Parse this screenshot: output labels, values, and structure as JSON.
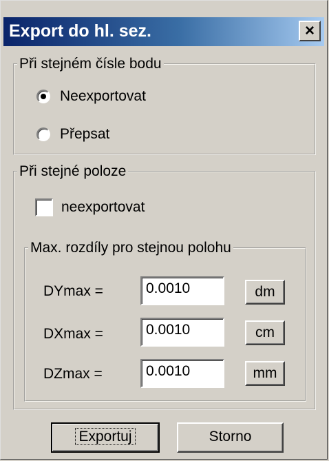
{
  "window": {
    "title": "Export do hl. sez.",
    "close_symbol": "×",
    "close_icon": "close-icon"
  },
  "same_point_number": {
    "legend": "Při stejném čísle bodu",
    "options": [
      {
        "label": "Neexportovat",
        "selected": true
      },
      {
        "label": "Přepsat",
        "selected": false
      }
    ]
  },
  "same_position": {
    "legend": "Při stejné poloze",
    "checkbox": {
      "label": "neexportovat",
      "checked": false
    },
    "max_diff": {
      "legend": "Max. rozdíly pro stejnou polohu",
      "rows": [
        {
          "label": "DYmax =",
          "value": "0.0010",
          "unit": "dm"
        },
        {
          "label": "DXmax =",
          "value": "0.0010",
          "unit": "cm"
        },
        {
          "label": "DZmax =",
          "value": "0.0010",
          "unit": "mm"
        }
      ]
    }
  },
  "buttons": {
    "export": "Exportuj",
    "cancel": "Storno"
  }
}
